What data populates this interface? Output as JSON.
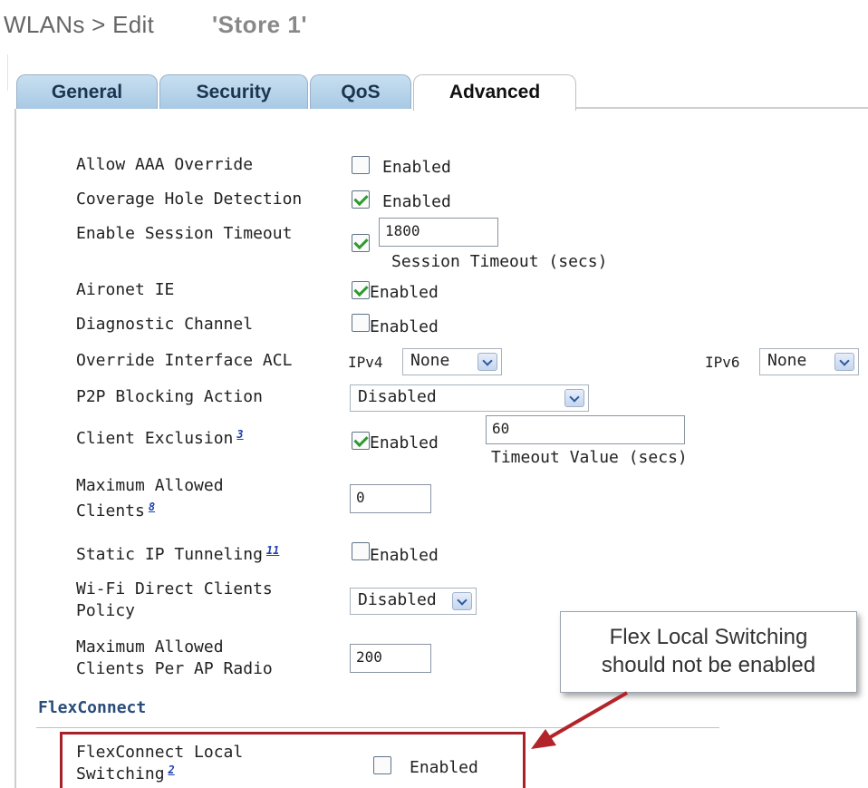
{
  "header": {
    "breadcrumb": "WLANs > Edit",
    "wlan_name": "'Store 1'"
  },
  "tabs": [
    {
      "label": "General",
      "active": false
    },
    {
      "label": "Security",
      "active": false
    },
    {
      "label": "QoS",
      "active": false
    },
    {
      "label": "Advanced",
      "active": true
    }
  ],
  "advanced": {
    "allow_aaa_override": {
      "label": "Allow AAA Override",
      "checked": false,
      "value_label": "Enabled"
    },
    "coverage_hole_detection": {
      "label": "Coverage Hole Detection",
      "checked": true,
      "value_label": "Enabled"
    },
    "session_timeout": {
      "label": "Enable Session Timeout",
      "checked": true,
      "value": "1800",
      "caption": "Session Timeout (secs)"
    },
    "aironet_ie": {
      "label": "Aironet IE",
      "checked": true,
      "value_label": "Enabled"
    },
    "diagnostic_channel": {
      "label": "Diagnostic Channel",
      "checked": false,
      "value_label": "Enabled"
    },
    "override_interface_acl": {
      "label": "Override Interface ACL",
      "ipv4_label": "IPv4",
      "ipv4_value": "None",
      "ipv6_label": "IPv6",
      "ipv6_value": "None"
    },
    "p2p_blocking": {
      "label": "P2P Blocking Action",
      "value": "Disabled"
    },
    "client_exclusion": {
      "label": "Client Exclusion",
      "footnote": "3",
      "checked": true,
      "value_label": "Enabled",
      "timeout": "60",
      "caption": "Timeout Value (secs)"
    },
    "max_allowed_clients": {
      "label_line1": "Maximum Allowed",
      "label_line2": "Clients",
      "footnote": "8",
      "value": "0"
    },
    "static_ip_tunneling": {
      "label": "Static IP Tunneling",
      "footnote": "11",
      "checked": false,
      "value_label": "Enabled"
    },
    "wifi_direct": {
      "label_line1": "Wi-Fi Direct Clients",
      "label_line2": "Policy",
      "value": "Disabled"
    },
    "max_clients_per_ap_radio": {
      "label_line1": "Maximum Allowed",
      "label_line2": "Clients Per AP Radio",
      "value": "200"
    }
  },
  "flexconnect": {
    "section_title": "FlexConnect",
    "local_switching": {
      "label_line1": "FlexConnect Local",
      "label_line2": "Switching",
      "footnote": "2",
      "checked": false,
      "value_label": "Enabled"
    }
  },
  "callout": {
    "line1": "Flex Local Switching",
    "line2": "should not be enabled",
    "border_color": "#a8202a"
  }
}
